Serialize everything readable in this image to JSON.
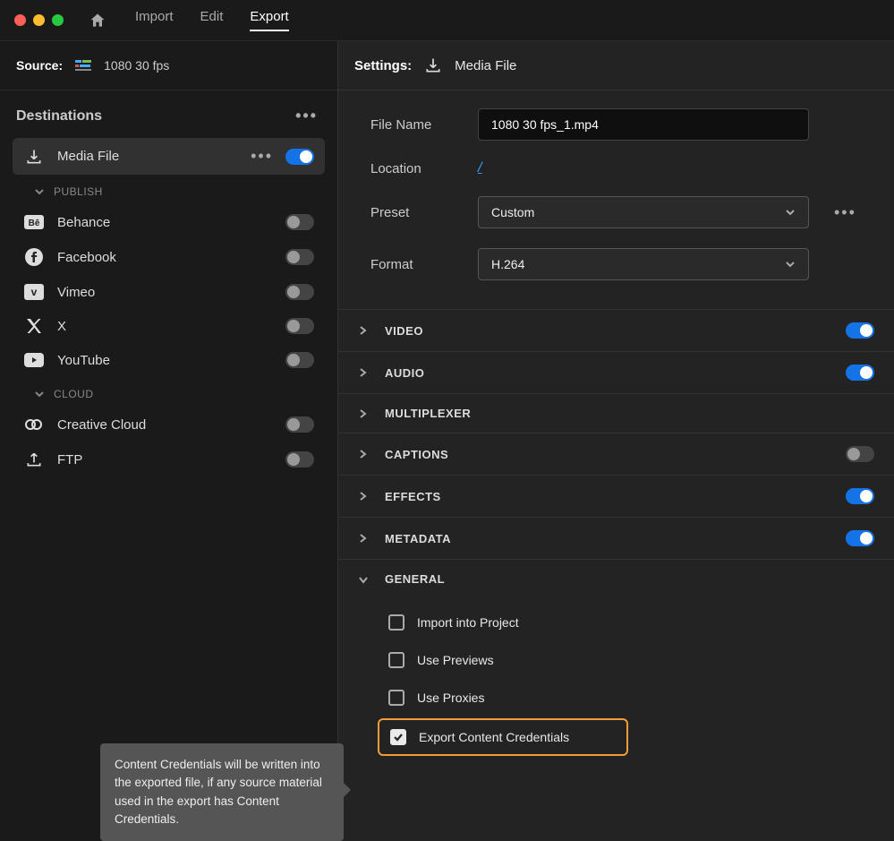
{
  "nav": {
    "tabs": {
      "import": "Import",
      "edit": "Edit",
      "export": "Export"
    }
  },
  "source": {
    "label": "Source:",
    "name": "1080 30 fps"
  },
  "sidebar": {
    "destinations_label": "Destinations",
    "publish_label": "PUBLISH",
    "cloud_label": "CLOUD",
    "items": {
      "media_file": "Media File",
      "behance": "Behance",
      "facebook": "Facebook",
      "vimeo": "Vimeo",
      "x": "X",
      "youtube": "YouTube",
      "creative_cloud": "Creative Cloud",
      "ftp": "FTP"
    }
  },
  "settings": {
    "label": "Settings:",
    "destination": "Media File",
    "file_name_label": "File Name",
    "file_name_value": "1080 30 fps_1.mp4",
    "location_label": "Location",
    "location_value": "/",
    "preset_label": "Preset",
    "preset_value": "Custom",
    "format_label": "Format",
    "format_value": "H.264"
  },
  "accordion": {
    "video": "VIDEO",
    "audio": "AUDIO",
    "multiplexer": "MULTIPLEXER",
    "captions": "CAPTIONS",
    "effects": "EFFECTS",
    "metadata": "METADATA",
    "general": "GENERAL"
  },
  "general": {
    "import_project": "Import into Project",
    "use_previews": "Use Previews",
    "use_proxies": "Use Proxies",
    "export_credentials": "Export Content Credentials"
  },
  "tooltip": "Content Credentials will be written into the exported file, if any source material used in the export has Content Credentials."
}
